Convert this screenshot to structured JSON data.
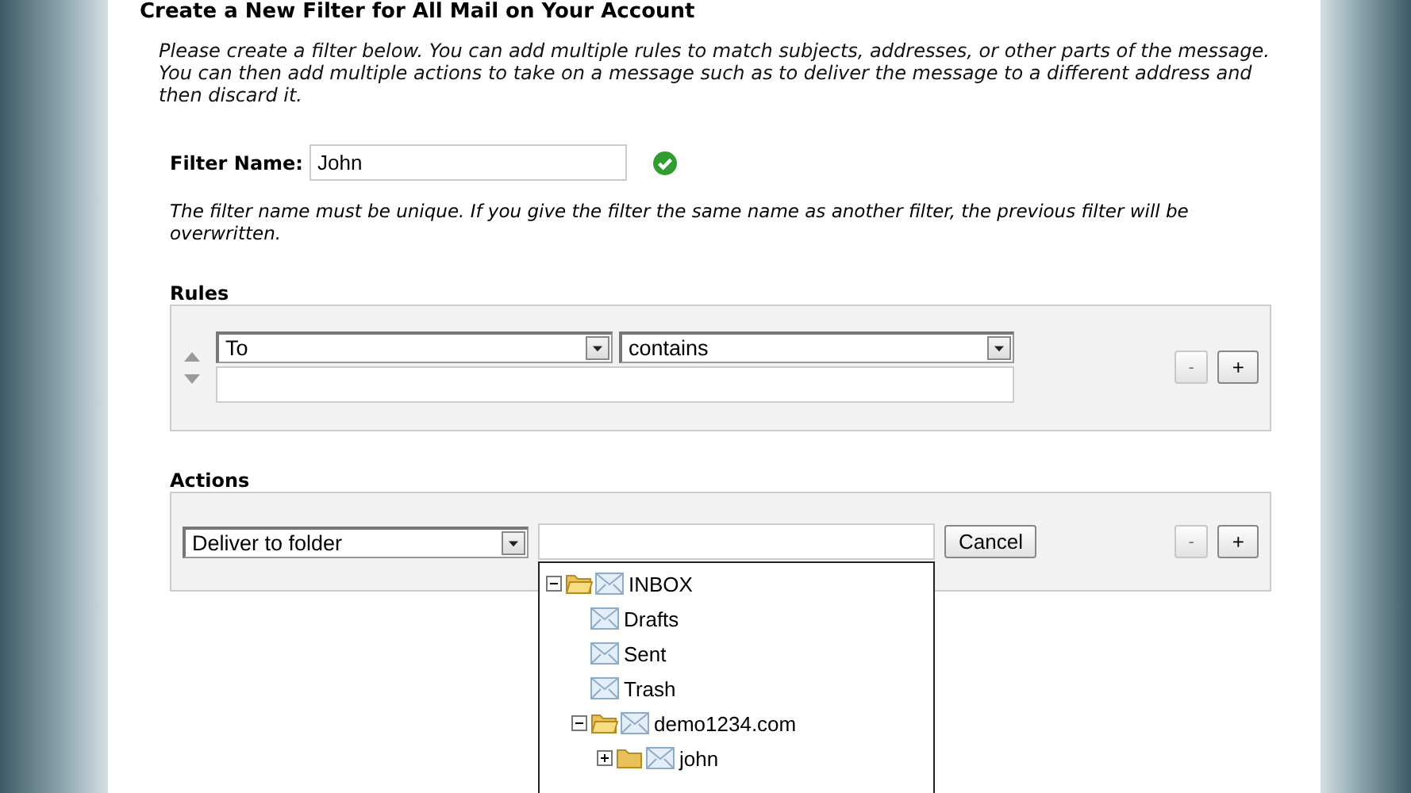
{
  "page": {
    "title": "Create a New Filter for All Mail on Your Account",
    "intro": "Please create a filter below. You can add multiple rules to match subjects, addresses, or other parts of the message. You can then add multiple actions to take on a message such as to deliver the message to a different address and then discard it."
  },
  "filter_name": {
    "label": "Filter Name:",
    "value": "John",
    "valid": true
  },
  "note": "The filter name must be unique. If you give the filter the same name as another filter, the previous filter will be overwritten.",
  "rules": {
    "heading": "Rules",
    "items": [
      {
        "field": "To",
        "operator": "contains",
        "remove": {
          "label": "-",
          "disabled": true
        },
        "add": {
          "label": "+",
          "disabled": false
        }
      }
    ]
  },
  "actions": {
    "heading": "Actions",
    "items": [
      {
        "action": "Deliver to folder",
        "cancel": "Cancel",
        "remove": {
          "label": "-",
          "disabled": true
        },
        "add": {
          "label": "+",
          "disabled": false
        },
        "folder_picker": {
          "open": true,
          "folders": [
            {
              "label": "INBOX",
              "expanded": true,
              "children": [
                {
                  "label": "Drafts"
                },
                {
                  "label": "Sent"
                },
                {
                  "label": "Trash"
                },
                {
                  "label": "demo1234.com",
                  "expanded": true,
                  "children": [
                    {
                      "label": "john",
                      "expanded": false
                    }
                  ]
                }
              ]
            }
          ]
        }
      }
    ]
  }
}
